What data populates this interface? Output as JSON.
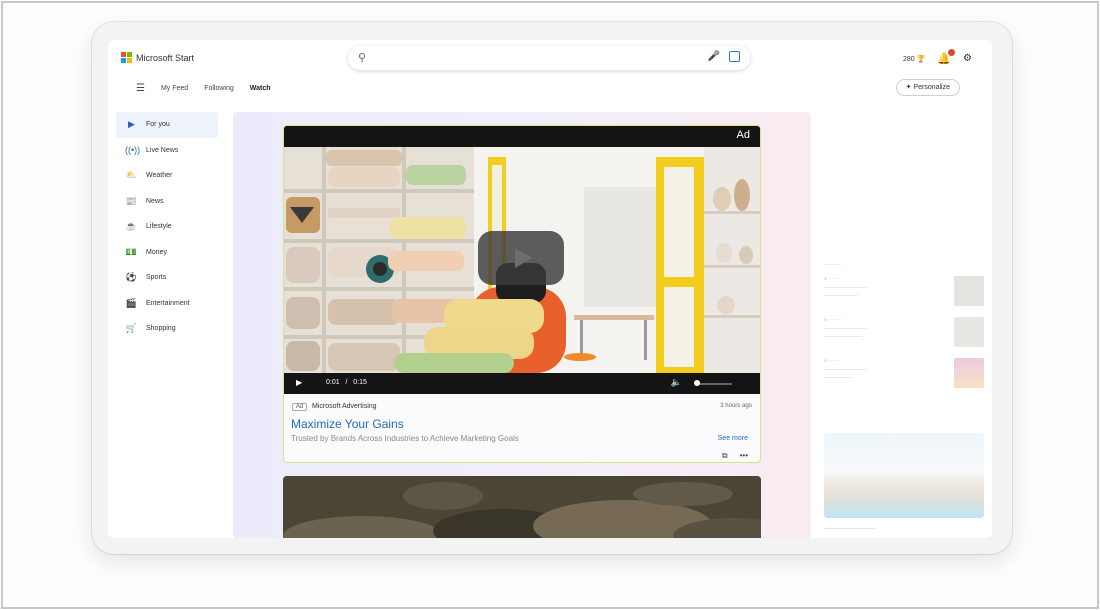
{
  "header": {
    "brand": "Microsoft Start",
    "search_placeholder": "",
    "points": "280"
  },
  "nav": {
    "tabs": [
      {
        "label": "My Feed"
      },
      {
        "label": "Following"
      },
      {
        "label": "Watch"
      }
    ],
    "personalize": "Personalize"
  },
  "sidebar": {
    "items": [
      {
        "label": "For you",
        "icon": "play-icon"
      },
      {
        "label": "Live News",
        "icon": "broadcast-icon"
      },
      {
        "label": "Weather",
        "icon": "weather-icon"
      },
      {
        "label": "News",
        "icon": "news-icon"
      },
      {
        "label": "Lifestyle",
        "icon": "lifestyle-icon"
      },
      {
        "label": "Money",
        "icon": "money-icon"
      },
      {
        "label": "Sports",
        "icon": "sports-icon"
      },
      {
        "label": "Entertainment",
        "icon": "entertainment-icon"
      },
      {
        "label": "Shopping",
        "icon": "shopping-cart-icon"
      }
    ]
  },
  "video_card": {
    "ad_label": "Ad",
    "current_time": "0:01",
    "separator": "/",
    "duration": "0:15",
    "volume_level": 0.1,
    "ad_badge": "Ad",
    "provider": "Microsoft Advertising",
    "age": "3 hours ago",
    "title": "Maximize Your Gains",
    "description": "Trusted by Brands Across Industries to Achieve Marketing Goals",
    "see_more": "See more"
  },
  "colors": {
    "accent": "#1f6bc2",
    "notification_badge": "#e0462a",
    "card_border": "#d8e48a"
  }
}
